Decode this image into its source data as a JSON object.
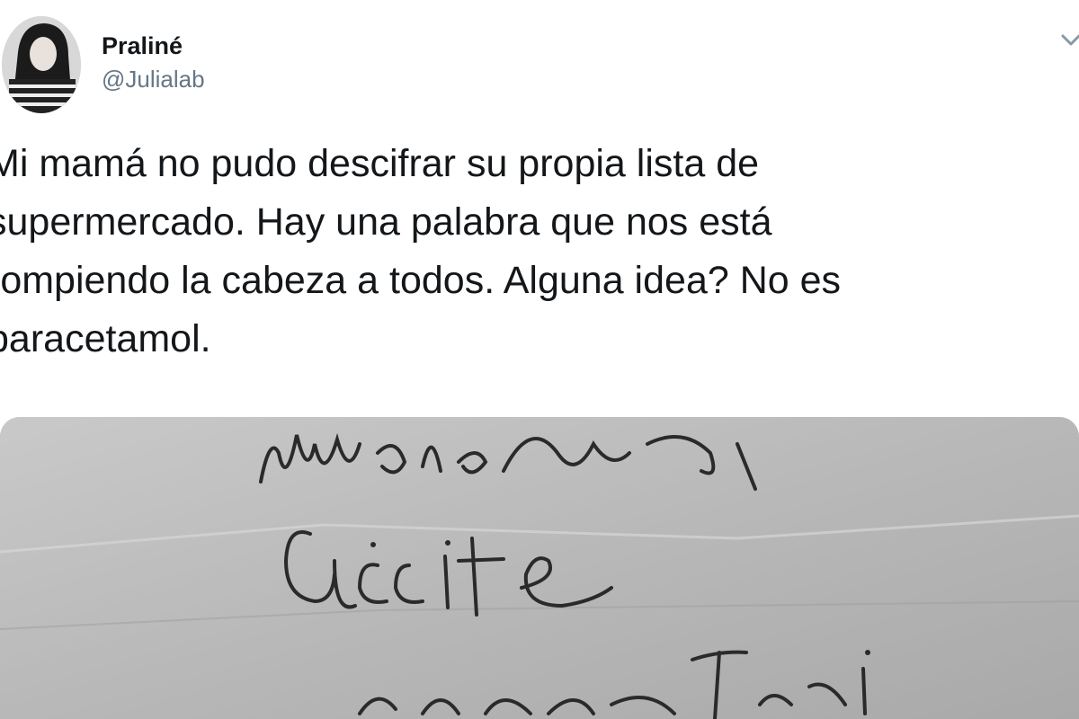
{
  "tweet": {
    "author": {
      "display_name": "Praliné",
      "handle": "@Julialab"
    },
    "text": "Mi mamá no pudo descifrar su propia lista de\nsupermercado. Hay una palabra que nos está\nrompiendo la cabeza a todos. Alguna idea? No es\nparacetamol.",
    "menu_icon": "chevron-down-icon",
    "media": {
      "type": "photo",
      "description_icon": "handwritten-note-image"
    }
  },
  "colors": {
    "text": "#14171a",
    "secondary": "#657786",
    "photo_bg": "#b4b4b4",
    "ink": "#2a2a2a"
  }
}
